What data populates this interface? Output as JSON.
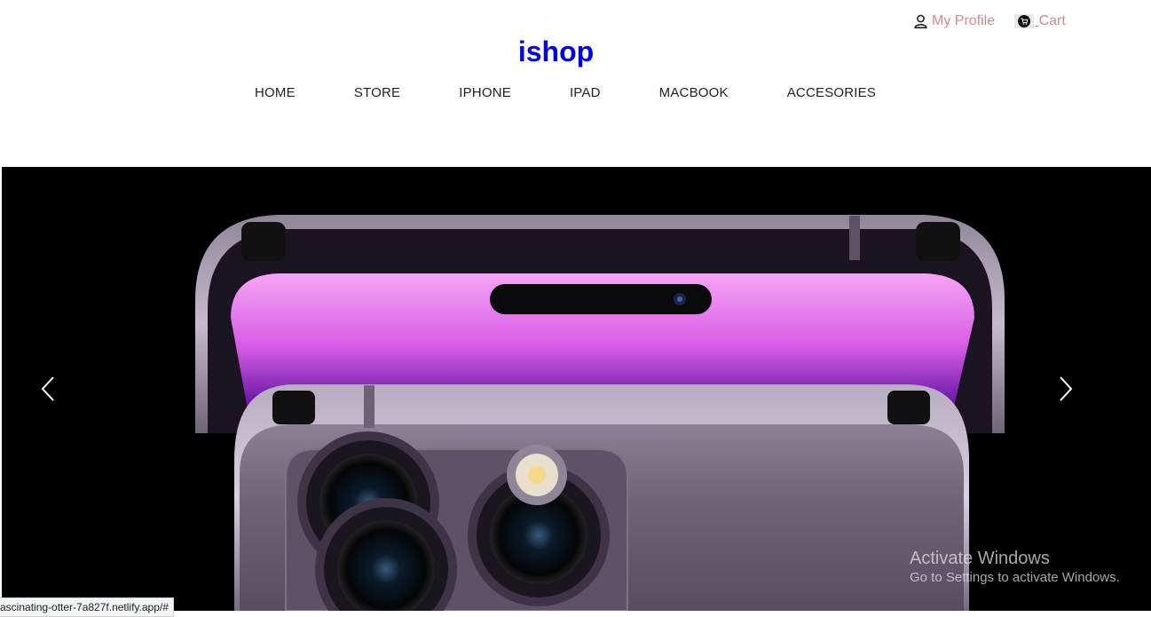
{
  "header": {
    "profile_label": "My Profile",
    "cart_label": "Cart",
    "brand": "ishop"
  },
  "nav": {
    "items": [
      "HOME",
      "STORE",
      "IPHONE",
      "IPAD",
      "MACBOOK",
      "ACCESORIES"
    ]
  },
  "hero": {
    "image": "iPhone 14 Pro deep purple",
    "prev_icon": "chevron-left-icon",
    "next_icon": "chevron-right-icon"
  },
  "watermark": {
    "title": "Activate Windows",
    "subtitle": "Go to Settings to activate Windows."
  },
  "status": {
    "url": "ascinating-otter-7a827f.netlify.app/#"
  },
  "colors": {
    "brand": "#0000ee",
    "top_link": "#d48a8a",
    "hero_bg": "#000000"
  }
}
